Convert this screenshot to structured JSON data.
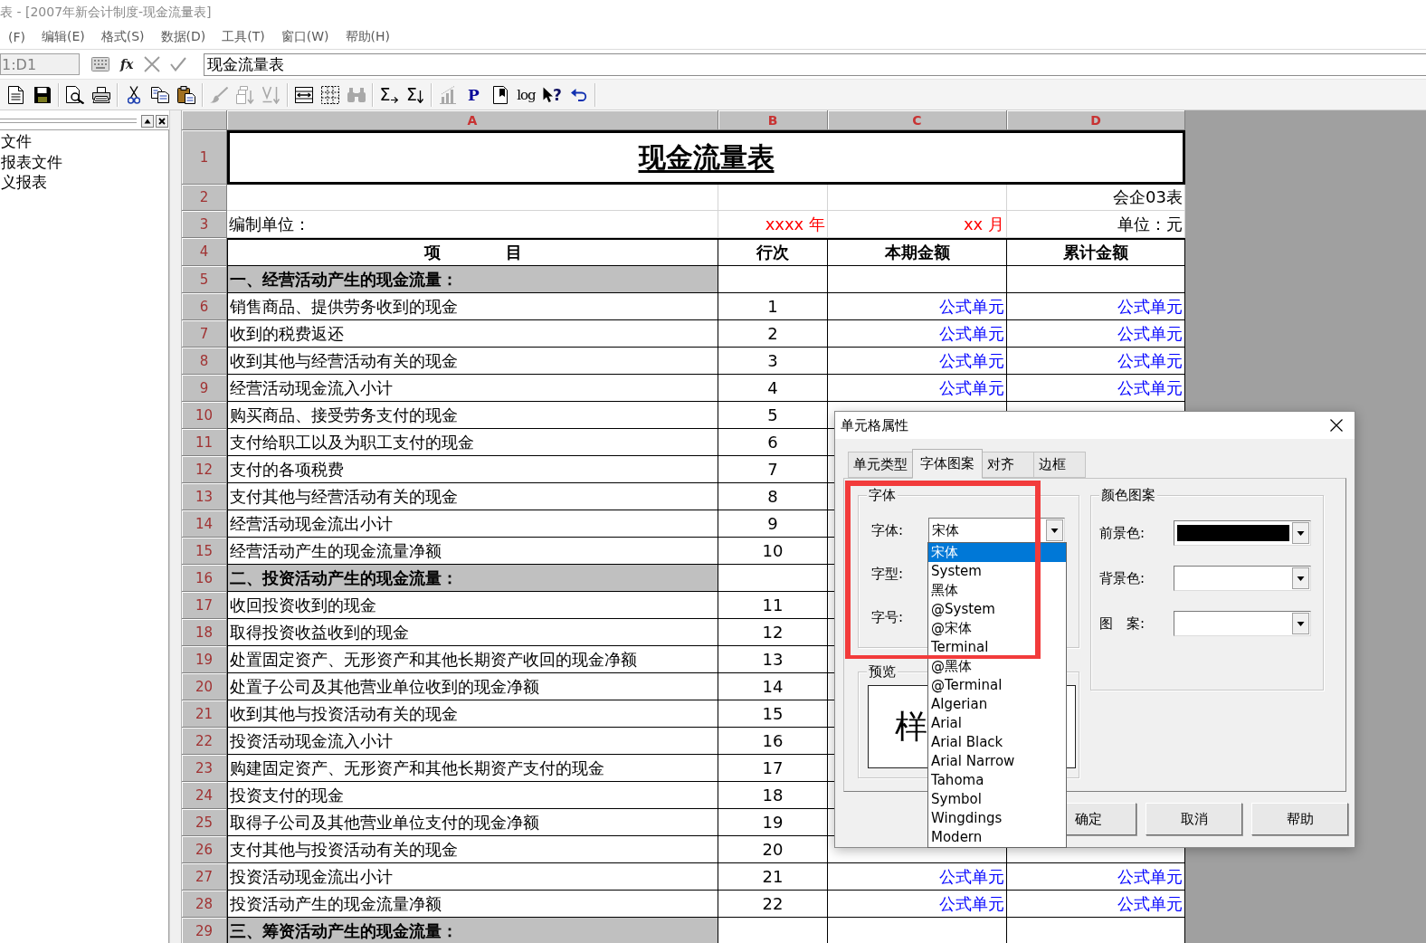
{
  "window": {
    "title": "表 - [2007年新会计制度-现金流量表]"
  },
  "menu": [
    "(F)",
    "编辑(E)",
    "格式(S)",
    "数据(D)",
    "工具(T)",
    "窗口(W)",
    "帮助(H)"
  ],
  "formula_bar": {
    "cell_ref": "1:D1",
    "function_label": "fx",
    "value": "现金流量表"
  },
  "toolbar": [
    [
      {
        "kind": "new",
        "disabled": false
      },
      {
        "kind": "save",
        "disabled": false
      }
    ],
    [
      {
        "kind": "preview",
        "disabled": false
      },
      {
        "kind": "print",
        "disabled": false
      }
    ],
    [
      {
        "kind": "cut",
        "disabled": false
      },
      {
        "kind": "copy",
        "disabled": false
      },
      {
        "kind": "paste",
        "disabled": false
      }
    ],
    [
      {
        "kind": "brush",
        "disabled": true
      },
      {
        "kind": "filldown",
        "disabled": true
      },
      {
        "kind": "sortdown",
        "disabled": true
      }
    ],
    [
      {
        "kind": "frame",
        "disabled": false
      },
      {
        "kind": "grid",
        "disabled": false
      },
      {
        "kind": "find",
        "disabled": true
      }
    ],
    [
      {
        "kind": "sum",
        "text": "Σ",
        "disabled": false
      },
      {
        "kind": "sumdown",
        "text": "Σ",
        "disabled": false
      }
    ],
    [
      {
        "kind": "chart",
        "disabled": true
      },
      {
        "kind": "bold",
        "text": "P",
        "disabled": false
      },
      {
        "kind": "page",
        "disabled": false
      },
      {
        "kind": "plain",
        "text": "log",
        "disabled": false
      },
      {
        "kind": "help",
        "text": "?",
        "disabled": false
      },
      {
        "kind": "undo",
        "disabled": false
      }
    ]
  ],
  "side_panel": {
    "items": [
      "文件",
      "报表文件",
      "义报表"
    ]
  },
  "sheet": {
    "columns": [
      "A",
      "B",
      "C",
      "D"
    ],
    "rows": [
      {
        "header": "1",
        "kind": "title",
        "title": "现金流量表"
      },
      {
        "header": "2",
        "kind": "note",
        "d": "会企03表"
      },
      {
        "header": "3",
        "kind": "note",
        "a": "编制单位：",
        "b": {
          "text": "xxxx 年",
          "color": "#ff0000"
        },
        "c": {
          "text": "xx 月",
          "color": "#ff0000"
        },
        "d": "单位：元"
      },
      {
        "header": "4",
        "kind": "header",
        "a": "项　　　　目",
        "b": "行次",
        "c": "本期金额",
        "d": "累计金额"
      },
      {
        "header": "5",
        "kind": "section",
        "a": "一、经营活动产生的现金流量："
      },
      {
        "header": "6",
        "kind": "item",
        "a": "销售商品、提供劳务收到的现金",
        "b": "1",
        "c": {
          "text": "公式单元",
          "color": "#0000ff"
        },
        "d": {
          "text": "公式单元",
          "color": "#0000ff"
        }
      },
      {
        "header": "7",
        "kind": "item",
        "a": "收到的税费返还",
        "b": "2",
        "c": {
          "text": "公式单元",
          "color": "#0000ff"
        },
        "d": {
          "text": "公式单元",
          "color": "#0000ff"
        }
      },
      {
        "header": "8",
        "kind": "item",
        "a": "收到其他与经营活动有关的现金",
        "b": "3",
        "c": {
          "text": "公式单元",
          "color": "#0000ff"
        },
        "d": {
          "text": "公式单元",
          "color": "#0000ff"
        }
      },
      {
        "header": "9",
        "kind": "item",
        "a": "经营活动现金流入小计",
        "b": "4",
        "c": {
          "text": "公式单元",
          "color": "#0000ff"
        },
        "d": {
          "text": "公式单元",
          "color": "#0000ff"
        }
      },
      {
        "header": "10",
        "kind": "item",
        "a": "购买商品、接受劳务支付的现金",
        "b": "5"
      },
      {
        "header": "11",
        "kind": "item",
        "a": "支付给职工以及为职工支付的现金",
        "b": "6"
      },
      {
        "header": "12",
        "kind": "item",
        "a": "支付的各项税费",
        "b": "7"
      },
      {
        "header": "13",
        "kind": "item",
        "a": "支付其他与经营活动有关的现金",
        "b": "8"
      },
      {
        "header": "14",
        "kind": "item",
        "a": "经营活动现金流出小计",
        "b": "9"
      },
      {
        "header": "15",
        "kind": "item",
        "a": "经营活动产生的现金流量净额",
        "b": "10"
      },
      {
        "header": "16",
        "kind": "section",
        "a": "二、投资活动产生的现金流量："
      },
      {
        "header": "17",
        "kind": "item",
        "a": "收回投资收到的现金",
        "b": "11"
      },
      {
        "header": "18",
        "kind": "item",
        "a": "取得投资收益收到的现金",
        "b": "12"
      },
      {
        "header": "19",
        "kind": "item",
        "a": "处置固定资产、无形资产和其他长期资产收回的现金净额",
        "b": "13"
      },
      {
        "header": "20",
        "kind": "item",
        "a": "处置子公司及其他营业单位收到的现金净额",
        "b": "14"
      },
      {
        "header": "21",
        "kind": "item",
        "a": "收到其他与投资活动有关的现金",
        "b": "15"
      },
      {
        "header": "22",
        "kind": "item",
        "a": "投资活动现金流入小计",
        "b": "16"
      },
      {
        "header": "23",
        "kind": "item",
        "a": "购建固定资产、无形资产和其他长期资产支付的现金",
        "b": "17"
      },
      {
        "header": "24",
        "kind": "item",
        "a": "投资支付的现金",
        "b": "18"
      },
      {
        "header": "25",
        "kind": "item",
        "a": "取得子公司及其他营业单位支付的现金净额",
        "b": "19"
      },
      {
        "header": "26",
        "kind": "item",
        "a": "支付其他与投资活动有关的现金",
        "b": "20"
      },
      {
        "header": "27",
        "kind": "item",
        "a": "投资活动现金流出小计",
        "b": "21",
        "c": {
          "text": "公式单元",
          "color": "#0000ff"
        },
        "d": {
          "text": "公式单元",
          "color": "#0000ff"
        }
      },
      {
        "header": "28",
        "kind": "item",
        "a": "投资活动产生的现金流量净额",
        "b": "22",
        "c": {
          "text": "公式单元",
          "color": "#0000ff"
        },
        "d": {
          "text": "公式单元",
          "color": "#0000ff"
        }
      },
      {
        "header": "29",
        "kind": "section",
        "a": "三、筹资活动产生的现金流量："
      }
    ]
  },
  "dialog": {
    "title": "单元格属性",
    "tabs": [
      {
        "label": "单元类型",
        "selected": false
      },
      {
        "label": "字体图案",
        "selected": true
      },
      {
        "label": "对齐",
        "selected": false
      },
      {
        "label": "边框",
        "selected": false
      }
    ],
    "font_group": {
      "legend": "字体",
      "fields": [
        {
          "label": "字体:",
          "value": "宋体"
        },
        {
          "label": "字型:"
        },
        {
          "label": "字号:"
        }
      ]
    },
    "font_list": [
      {
        "label": "宋体",
        "selected": true
      },
      {
        "label": "System",
        "selected": false
      },
      {
        "label": "黑体",
        "selected": false
      },
      {
        "label": "@System",
        "selected": false
      },
      {
        "label": "@宋体",
        "selected": false
      },
      {
        "label": "Terminal",
        "selected": false
      },
      {
        "label": "@黑体",
        "selected": false
      },
      {
        "label": "@Terminal",
        "selected": false
      },
      {
        "label": "Algerian",
        "selected": false
      },
      {
        "label": "Arial",
        "selected": false
      },
      {
        "label": "Arial Black",
        "selected": false
      },
      {
        "label": "Arial Narrow",
        "selected": false
      },
      {
        "label": "Tahoma",
        "selected": false
      },
      {
        "label": "Symbol",
        "selected": false
      },
      {
        "label": "Wingdings",
        "selected": false
      },
      {
        "label": "Modern",
        "selected": false
      }
    ],
    "preview": {
      "legend": "预览",
      "sample": "样"
    },
    "color_group": {
      "legend": "颜色图案",
      "fields": [
        {
          "label": "前景色:",
          "color": "#000000"
        },
        {
          "label": "背景色:"
        },
        {
          "label": "图　案:"
        }
      ]
    },
    "buttons": [
      "确定",
      "取消",
      "帮助"
    ]
  }
}
